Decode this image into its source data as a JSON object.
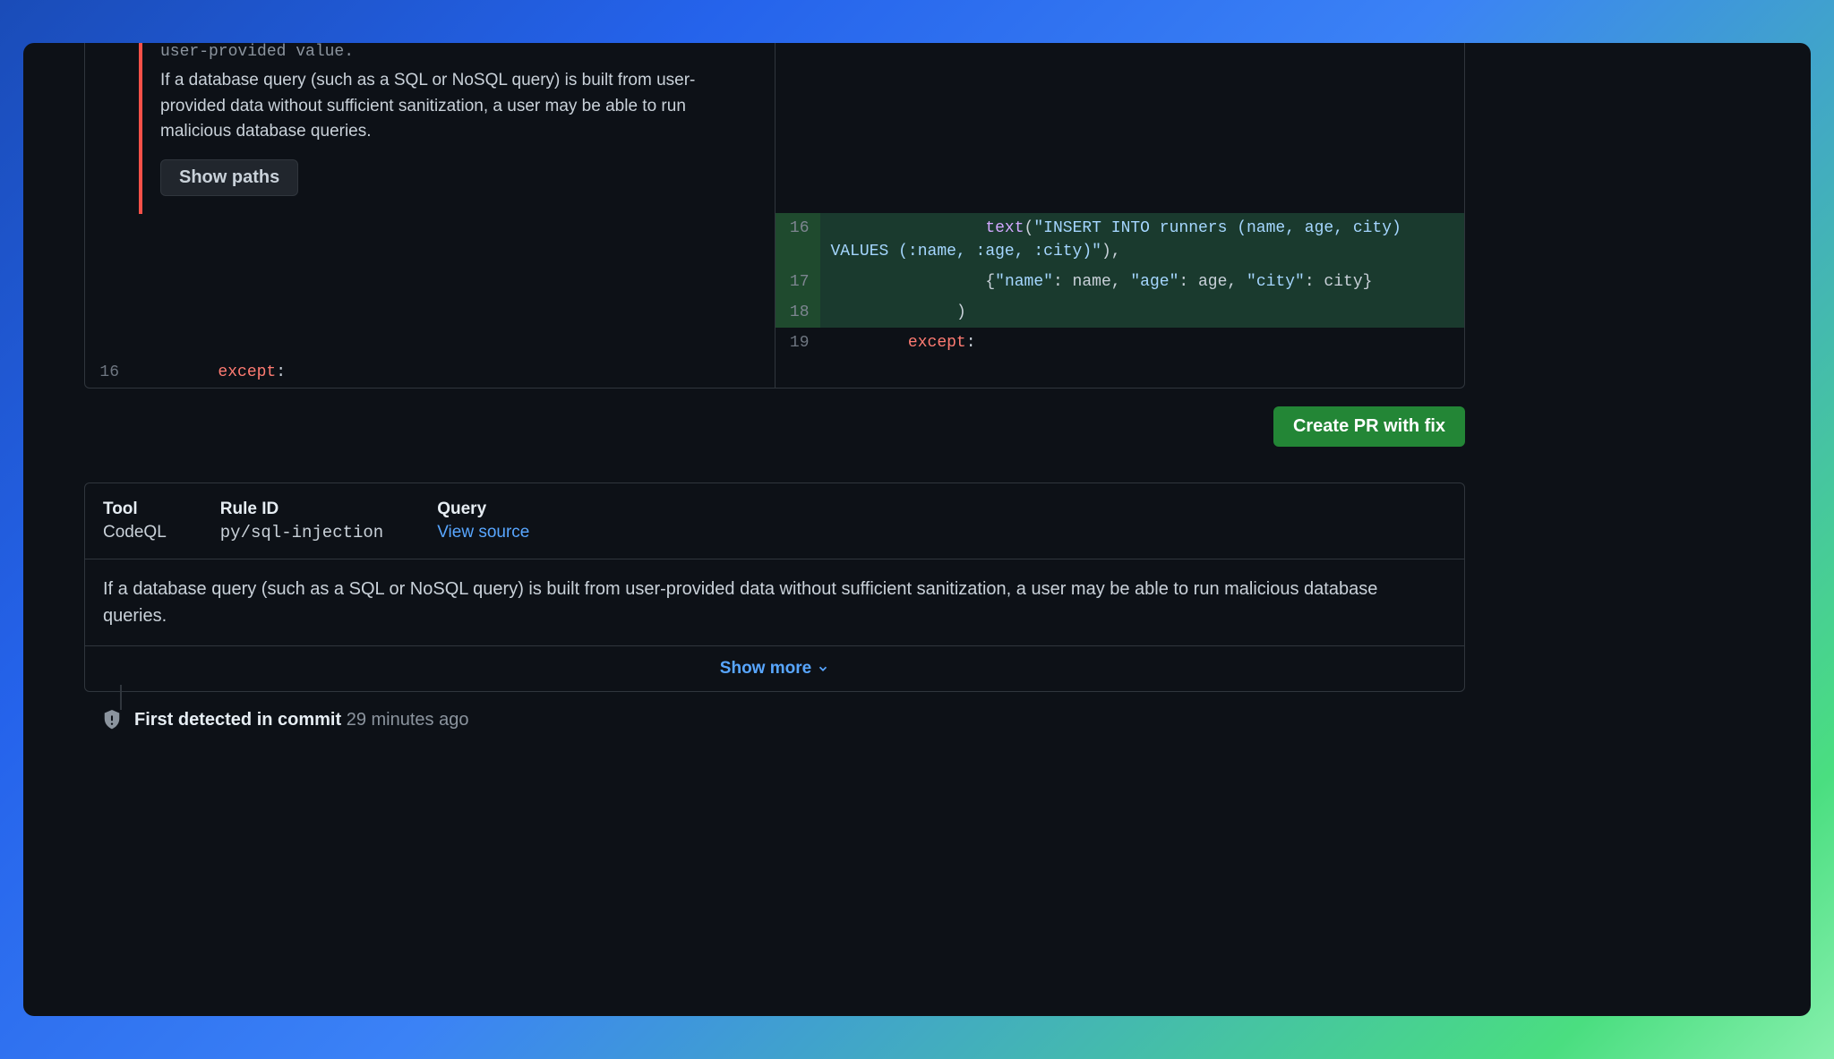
{
  "alert": {
    "title_truncated": "user-provided value.",
    "description": "If a database query (such as a SQL or NoSQL query) is built from user-provided data without sufficient sanitization, a user may be able to run malicious database queries.",
    "show_paths_label": "Show paths"
  },
  "diff": {
    "left": {
      "line16_num": "16",
      "line16_code": "        except:"
    },
    "right": {
      "line16_num": "16",
      "line16_code": "                text(\"INSERT INTO runners (name, age, city) VALUES (:name, :age, :city)\"),",
      "line17_num": "17",
      "line17_code": "                {\"name\": name, \"age\": age, \"city\": city}",
      "line18_num": "18",
      "line18_code": "             )",
      "line19_num": "19",
      "line19_code": "        except:"
    }
  },
  "create_pr_label": "Create PR with fix",
  "details": {
    "tool_label": "Tool",
    "tool_value": "CodeQL",
    "rule_label": "Rule ID",
    "rule_value": "py/sql-injection",
    "query_label": "Query",
    "query_link": "View source",
    "body": "If a database query (such as a SQL or NoSQL query) is built from user-provided data without sufficient sanitization, a user may be able to run malicious database queries.",
    "show_more_label": "Show more"
  },
  "timeline": {
    "prefix": "First detected in commit",
    "time": "29 minutes ago"
  }
}
